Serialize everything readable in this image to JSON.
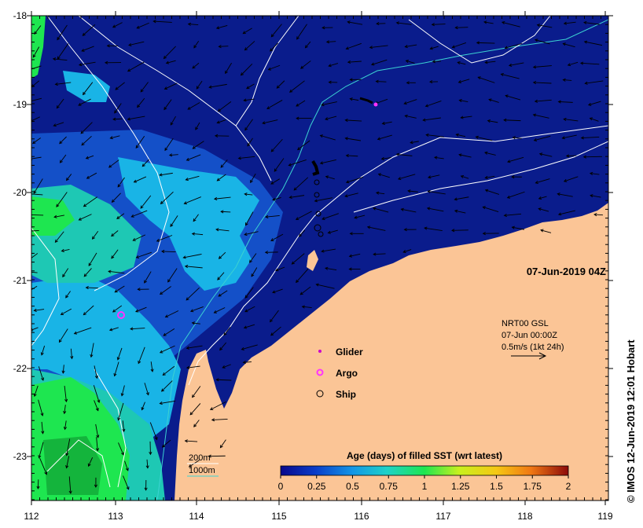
{
  "map": {
    "date_label": "07-Jun-2019 04Z",
    "credit": "© IMOS 12-Jun-2019 12:01 Hobart",
    "lon_ticks": [
      "112",
      "113",
      "114",
      "115",
      "116",
      "117",
      "118",
      "119"
    ],
    "lat_ticks": [
      "-18",
      "-19",
      "-20",
      "-21",
      "-22",
      "-23"
    ],
    "lon_range": [
      112,
      119
    ],
    "lat_range": [
      -23.5,
      -18
    ]
  },
  "current_info": {
    "line1": "NRT00 GSL",
    "line2": "07-Jun 00:00Z",
    "line3": "0.5m/s (1kt 24h)"
  },
  "platform_legend": {
    "glider": "Glider",
    "argo": "Argo",
    "ship": "Ship"
  },
  "contour_legend": {
    "c200": "200m",
    "c1000": "1000m"
  },
  "colorbar": {
    "title": "Age (days) of filled SST (wrt latest)",
    "ticks": [
      "0",
      "0.25",
      "0.5",
      "0.75",
      "1",
      "1.25",
      "1.5",
      "1.75",
      "2"
    ],
    "range": [
      0,
      2
    ]
  },
  "colors": {
    "land": "#fbc596",
    "deep_blue": "#0a1c8c",
    "mid_blue": "#1450c8",
    "light_blue": "#19b4e6",
    "teal": "#1ec8b4",
    "green": "#1ee650",
    "isobath_200": "#ffffff",
    "isobath_1000": "#3cd2d2",
    "argo": "#ff33ff",
    "glider": "#cc00cc"
  }
}
